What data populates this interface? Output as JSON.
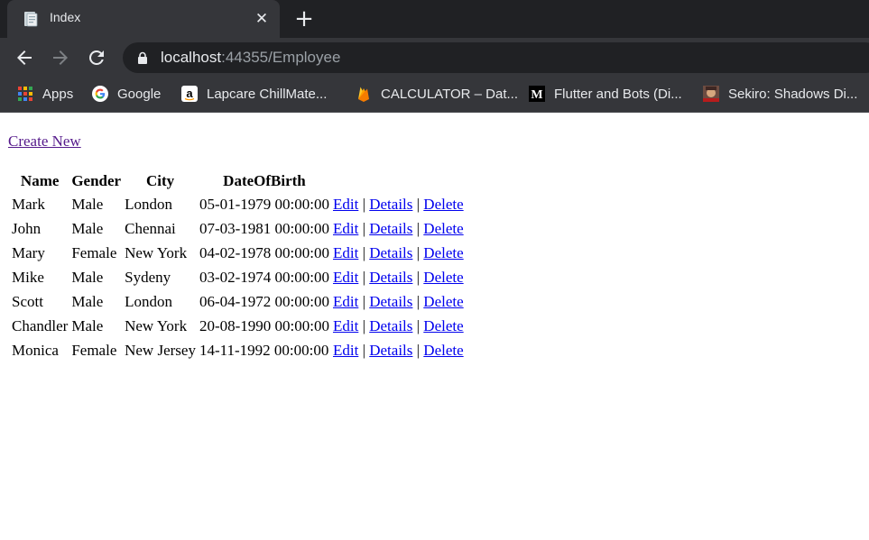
{
  "browser": {
    "tab_title": "Index",
    "tab_close": "✕",
    "new_tab": "+",
    "url_host": "localhost",
    "url_rest": ":44355/Employee",
    "bookmarks": [
      {
        "label": "Apps",
        "icon": "apps-grid-icon"
      },
      {
        "label": "Google",
        "icon": "google-icon"
      },
      {
        "label": "Lapcare ChillMate...",
        "icon": "amazon-icon"
      },
      {
        "label": "CALCULATOR – Dat...",
        "icon": "firebase-icon"
      },
      {
        "label": "Flutter and Bots (Di...",
        "icon": "medium-icon"
      },
      {
        "label": "Sekiro: Shadows Di...",
        "icon": "sekiro-thumbnail-icon"
      }
    ]
  },
  "page": {
    "create_new": "Create New",
    "headers": [
      "Name",
      "Gender",
      "City",
      "DateOfBirth"
    ],
    "actions": {
      "edit": "Edit",
      "details": "Details",
      "delete": "Delete",
      "separator": "|"
    },
    "rows": [
      {
        "name": "Mark",
        "gender": "Male",
        "city": "London",
        "dob": "05-01-1979 00:00:00"
      },
      {
        "name": "John",
        "gender": "Male",
        "city": "Chennai",
        "dob": "07-03-1981 00:00:00"
      },
      {
        "name": "Mary",
        "gender": "Female",
        "city": "New York",
        "dob": "04-02-1978 00:00:00"
      },
      {
        "name": "Mike",
        "gender": "Male",
        "city": "Sydeny",
        "dob": "03-02-1974 00:00:00"
      },
      {
        "name": "Scott",
        "gender": "Male",
        "city": "London",
        "dob": "06-04-1972 00:00:00"
      },
      {
        "name": "Chandler",
        "gender": "Male",
        "city": "New York",
        "dob": "20-08-1990 00:00:00"
      },
      {
        "name": "Monica",
        "gender": "Female",
        "city": "New Jersey",
        "dob": "14-11-1992 00:00:00"
      }
    ]
  },
  "colors": {
    "chrome_dark": "#202124",
    "chrome_toolbar": "#35363a",
    "visited_link": "#551a8b",
    "link": "#0000ee"
  }
}
